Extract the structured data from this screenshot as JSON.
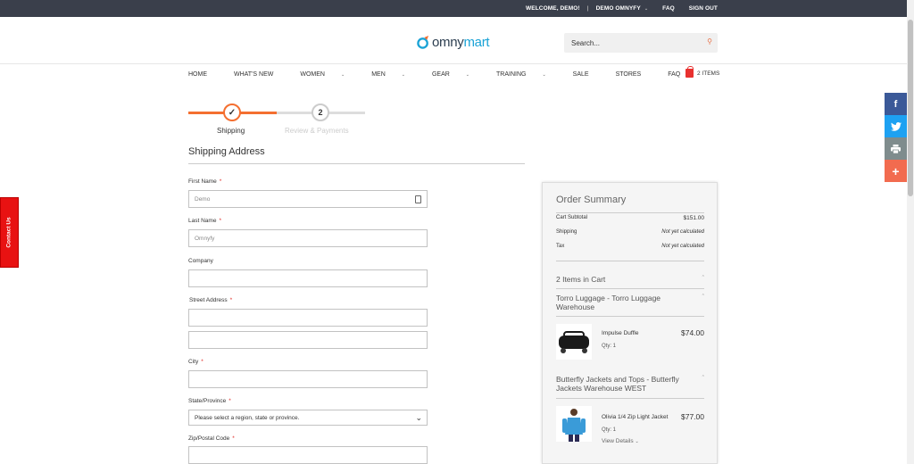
{
  "topbar": {
    "welcome": "WELCOME, DEMO!",
    "separator": "|",
    "account": "DEMO OMNYFY",
    "faq": "FAQ",
    "signout": "SIGN OUT"
  },
  "header": {
    "logo_text_left": "omny",
    "logo_text_right": "mart",
    "search_placeholder": "Search..."
  },
  "nav": {
    "items": [
      {
        "label": "HOME"
      },
      {
        "label": "WHAT'S NEW"
      },
      {
        "label": "WOMEN",
        "chevron": "⌄"
      },
      {
        "label": "MEN",
        "chevron": "⌄"
      },
      {
        "label": "GEAR",
        "chevron": "⌄"
      },
      {
        "label": "TRAINING",
        "chevron": "⌄"
      },
      {
        "label": "SALE"
      },
      {
        "label": "STORES"
      },
      {
        "label": "FAQ"
      }
    ],
    "cart_count": "2 ITEMS"
  },
  "progress": {
    "step1_label": "Shipping",
    "step2_number": "2",
    "step2_label": "Review & Payments"
  },
  "form": {
    "section_title": "Shipping Address",
    "first_name_label": "First Name",
    "first_name_value": "Demo",
    "last_name_label": "Last Name",
    "last_name_value": "Omnyfy",
    "company_label": "Company",
    "street_label": "Street Address",
    "city_label": "City",
    "state_label": "State/Province",
    "state_placeholder": "Please select a region, state or province.",
    "zip_label": "Zip/Postal Code",
    "required_mark": "*"
  },
  "summary": {
    "title": "Order Summary",
    "subtotal_label": "Cart Subtotal",
    "subtotal_value": "$151.00",
    "shipping_label": "Shipping",
    "shipping_value": "Not yet calculated",
    "tax_label": "Tax",
    "tax_value": "Not yet calculated",
    "items_in_cart": "2 Items in Cart",
    "vendors": [
      {
        "name": "Torro Luggage - Torro Luggage Warehouse",
        "product": "Impulse Duffle",
        "qty": "Qty: 1",
        "price": "$74.00"
      },
      {
        "name": "Butterfly Jackets and Tops - Butterfly Jackets Warehouse WEST",
        "product": "Olivia 1/4 Zip Light Jacket",
        "qty": "Qty: 1",
        "price": "$77.00",
        "details": "View Details"
      }
    ]
  },
  "sidebar": {
    "contact": "Contact Us"
  },
  "social": {
    "facebook": "f",
    "plus": "+"
  },
  "colors": {
    "topbar": "#3a3f4b",
    "accent": "#f46f30",
    "facebook": "#3b5998",
    "twitter": "#1da1f2",
    "print": "#7f8c8d",
    "plus": "#f26b4f",
    "contact": "#e81212"
  }
}
